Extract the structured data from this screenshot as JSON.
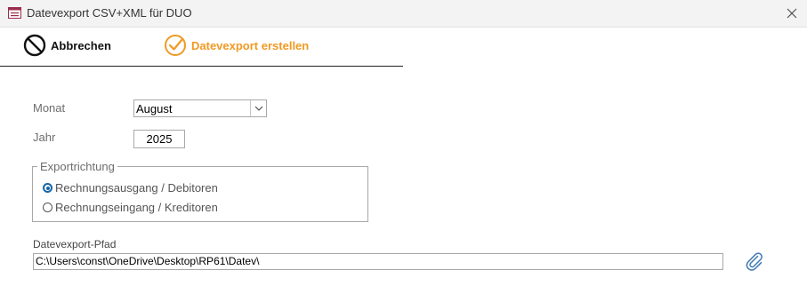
{
  "window": {
    "title": "Datevexport CSV+XML für DUO",
    "app_icon": "form-icon",
    "close_icon": "close-icon"
  },
  "toolbar": {
    "cancel_label": "Abbrechen",
    "cancel_icon": "prohibited-icon",
    "export_label": "Datevexport erstellen",
    "export_icon": "check-circle-icon",
    "export_color": "#f09a24"
  },
  "form": {
    "month_label": "Monat",
    "month_value": "August",
    "year_label": "Jahr",
    "year_value": "2025",
    "direction_legend": "Exportrichtung",
    "options": [
      {
        "label": "Rechnungsausgang / Debitoren",
        "selected": true
      },
      {
        "label": "Rechnungseingang / Kreditoren",
        "selected": false
      }
    ],
    "path_label": "Datevexport-Pfad",
    "path_value": "C:\\Users\\const\\OneDrive\\Desktop\\RP61\\Datev\\",
    "browse_icon": "paperclip-icon",
    "accent_color": "#1565a8"
  }
}
